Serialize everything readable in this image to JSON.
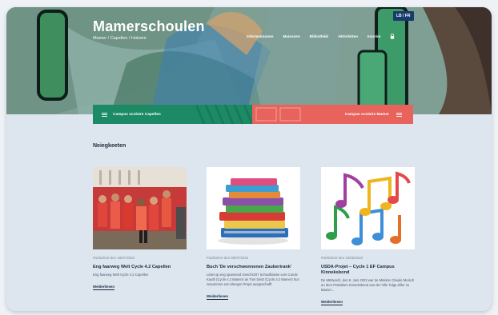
{
  "header": {
    "title": "Mamerschoulen",
    "subtitle": "Mamer / Capellen / Holzem",
    "lang_toggle": "LB / FR",
    "nav": [
      "Informatiounen",
      "Maisonen",
      "Bibliothéik",
      "Aktivitéiten",
      "Inscrire"
    ]
  },
  "campus": {
    "left_label": "Campus scolaire Capellen",
    "right_label": "Campus scolaire Mamer"
  },
  "news": {
    "heading": "Neiegkeeten",
    "items": [
      {
        "date": "Publizéiert den 18/07/2022",
        "title": "Eng faarweg Welt Cycle 4.2 Capellen",
        "desc": "Eng faarweg Welt Cycle 4.2 Capellen",
        "more": "Weiderliesen"
      },
      {
        "date": "Publizéiert den 05/07/2022",
        "title": "Buch 'De verschwonnenen Zauberirank'",
        "desc": "Léiwt op eng spannend Geschicht? Schoulklasse vum Carole Kauth (Cycle 4.2 Mamer) an Tom Dietz (Cycle 3.2 Mamer) hun zesummen een klengen Projet ausgeschafft",
        "more": "Weiderliesen"
      },
      {
        "date": "Publizéiert den 10/06/2022",
        "title": "USDA-Projet – Cycle 1 EF Campus Kinneksbond",
        "desc": "De Mëttwoch, den 8. Juni 2022 war de Minister Claude Meisch an dem Präsidium Kinneksbond aus der Ville Tolga Ziller zu Mamer...",
        "more": "Weiderliesen"
      }
    ]
  }
}
